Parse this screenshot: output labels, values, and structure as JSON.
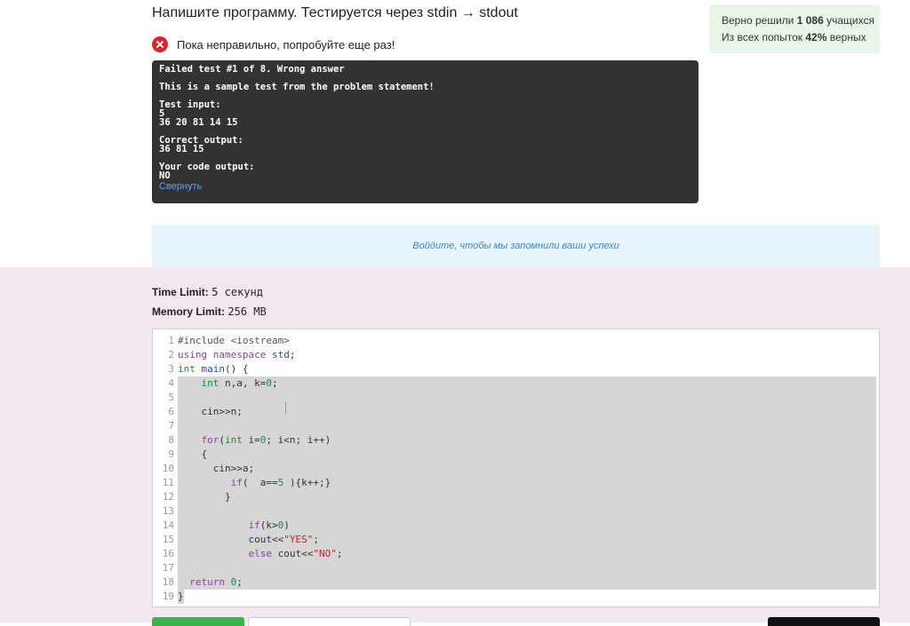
{
  "problem": {
    "title": "Напишите программу. Тестируется через stdin → stdout",
    "status_text": "Пока неправильно, попробуйте еще раз!"
  },
  "stats": {
    "line1_prefix": "Верно решили",
    "solved_count": "1 086",
    "line1_suffix": "учащихся",
    "line2_prefix": "Из всех попыток",
    "percent": "42%",
    "line2_suffix": "верных"
  },
  "result": {
    "header": "Failed test #1 of 8. Wrong answer",
    "note": "This is a sample test from the problem statement!",
    "input_label": "Test input:",
    "input_lines": [
      "5",
      "36 20 81 14 15"
    ],
    "correct_label": "Correct output:",
    "correct_lines": [
      "36 81 15"
    ],
    "your_label": "Your code output:",
    "your_lines": [
      "NO"
    ],
    "collapse_label": "Свернуть"
  },
  "login_banner": "Войдите, чтобы мы запомнили ваши успехи",
  "limits": {
    "time_label": "Time Limit:",
    "time_value": "5 секунд",
    "memory_label": "Memory Limit:",
    "memory_value": "256 MB"
  },
  "editor": {
    "line_numbers": [
      "1",
      "2",
      "3",
      "4",
      "5",
      "6",
      "7",
      "8",
      "9",
      "10",
      "11",
      "12",
      "13",
      "14",
      "15",
      "16",
      "17",
      "18",
      "19"
    ]
  },
  "colors": {
    "error_red": "#d9262c",
    "stats_bg": "#e9f7e9",
    "terminal_bg": "#323232",
    "banner_bg": "#e5f5fb",
    "section_bg": "#f3e8ef",
    "selection": "#d6d6d6"
  }
}
